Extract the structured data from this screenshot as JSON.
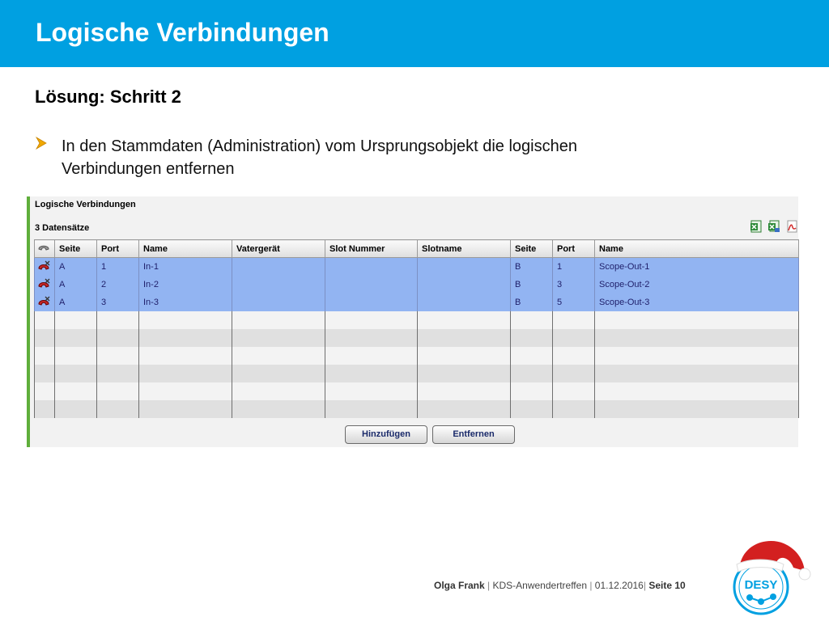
{
  "slide": {
    "title": "Logische Verbindungen",
    "subtitle": "Lösung: Schritt 2",
    "bullet_line1": "In den Stammdaten (Administration) vom Ursprungsobjekt die logischen",
    "bullet_line2": "Verbindungen entfernen"
  },
  "panel": {
    "title": "Logische Verbindungen",
    "record_count": "3 Datensätze",
    "columns": [
      "Seite",
      "Port",
      "Name",
      "Vatergerät",
      "Slot Nummer",
      "Slotname",
      "Seite",
      "Port",
      "Name"
    ],
    "rows": [
      {
        "seite_a": "A",
        "port_a": "1",
        "name_a": "In-1",
        "vatergeraet": "",
        "slot_nummer": "",
        "slotname": "",
        "seite_b": "B",
        "port_b": "1",
        "name_b": "Scope-Out-1"
      },
      {
        "seite_a": "A",
        "port_a": "2",
        "name_a": "In-2",
        "vatergeraet": "",
        "slot_nummer": "",
        "slotname": "",
        "seite_b": "B",
        "port_b": "3",
        "name_b": "Scope-Out-2"
      },
      {
        "seite_a": "A",
        "port_a": "3",
        "name_a": "In-3",
        "vatergeraet": "",
        "slot_nummer": "",
        "slotname": "",
        "seite_b": "B",
        "port_b": "5",
        "name_b": "Scope-Out-3"
      }
    ],
    "buttons": {
      "add": "Hinzufügen",
      "remove": "Entfernen"
    }
  },
  "footer": {
    "author": "Olga Frank",
    "sep1": " | ",
    "event": "KDS-Anwendertreffen",
    "sep2": " | ",
    "date": "01.12.2016",
    "sep3": "| ",
    "page": "Seite 10"
  },
  "logo": {
    "text": "DESY"
  },
  "colors": {
    "header": "#00a0e1",
    "selected_row": "#92b4f2",
    "panel_accent": "#5fae3b",
    "bullet": "#f0a800"
  }
}
